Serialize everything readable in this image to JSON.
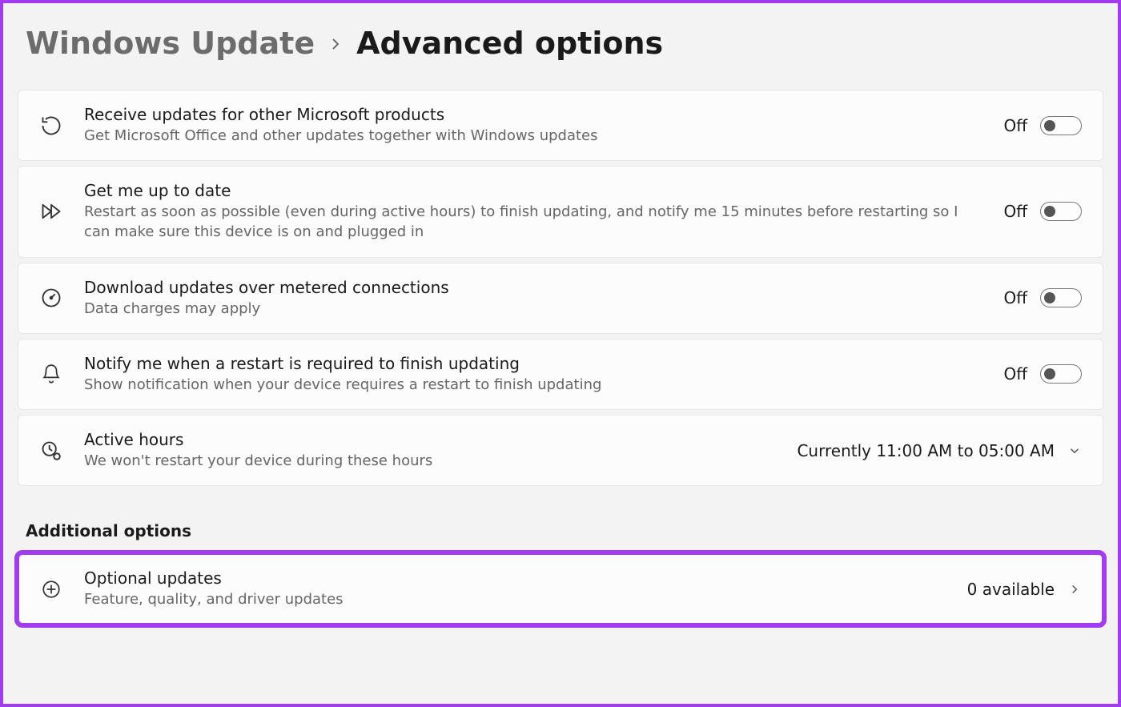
{
  "breadcrumb": {
    "parent": "Windows Update",
    "current": "Advanced options"
  },
  "items": [
    {
      "title": "Receive updates for other Microsoft products",
      "desc": "Get Microsoft Office and other updates together with Windows updates",
      "state": "Off"
    },
    {
      "title": "Get me up to date",
      "desc": "Restart as soon as possible (even during active hours) to finish updating, and notify me 15 minutes before restarting so I can make sure this device is on and plugged in",
      "state": "Off"
    },
    {
      "title": "Download updates over metered connections",
      "desc": "Data charges may apply",
      "state": "Off"
    },
    {
      "title": "Notify me when a restart is required to finish updating",
      "desc": "Show notification when your device requires a restart to finish updating",
      "state": "Off"
    },
    {
      "title": "Active hours",
      "desc": "We won't restart your device during these hours",
      "value": "Currently 11:00 AM to 05:00 AM"
    }
  ],
  "section_heading": "Additional options",
  "optional": {
    "title": "Optional updates",
    "desc": "Feature, quality, and driver updates",
    "value": "0 available"
  }
}
